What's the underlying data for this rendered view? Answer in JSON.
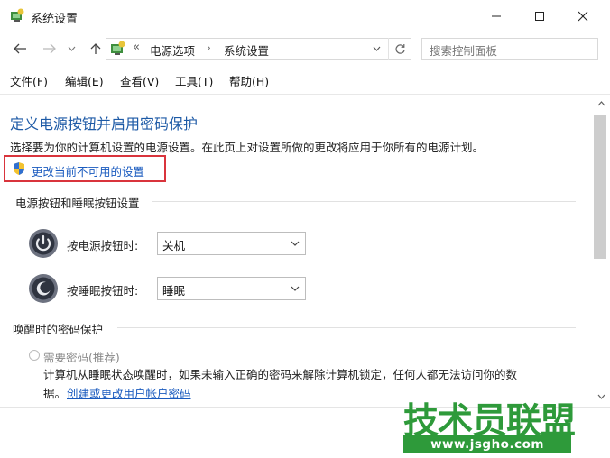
{
  "window": {
    "title": "系统设置"
  },
  "address": {
    "overflow": "«",
    "crumbs": [
      "电源选项",
      "系统设置"
    ],
    "arrow": "›",
    "search_placeholder": "搜索控制面板"
  },
  "menu": [
    "文件(F)",
    "编辑(E)",
    "查看(V)",
    "工具(T)",
    "帮助(H)"
  ],
  "content": {
    "heading": "定义电源按钮并启用密码保护",
    "description": "选择要为你的计算机设置的电源设置。在此页上对设置所做的更改将应用于你所有的电源计划。",
    "change_link": "更改当前不可用的设置",
    "section1": "电源按钮和睡眠按钮设置",
    "power_label": "按电源按钮时:",
    "power_value": "关机",
    "sleep_label": "按睡眠按钮时:",
    "sleep_value": "睡眠",
    "section2": "唤醒时的密码保护",
    "radio_label": "需要密码(推荐)",
    "radio_desc_line1": "计算机从睡眠状态唤醒时，如果未输入正确的密码来解除计算机锁定，任何人都无法访问你的数",
    "radio_desc_line2": "据。",
    "password_link": "创建或更改用户帐户密码"
  },
  "watermark": {
    "title": "技术员联盟",
    "url": "www.jsgho.com"
  },
  "colors": {
    "heading": "#1d5aa6",
    "link": "#1a5bbf",
    "highlight": "#d9343c",
    "watermark": "#2e9a3a"
  }
}
